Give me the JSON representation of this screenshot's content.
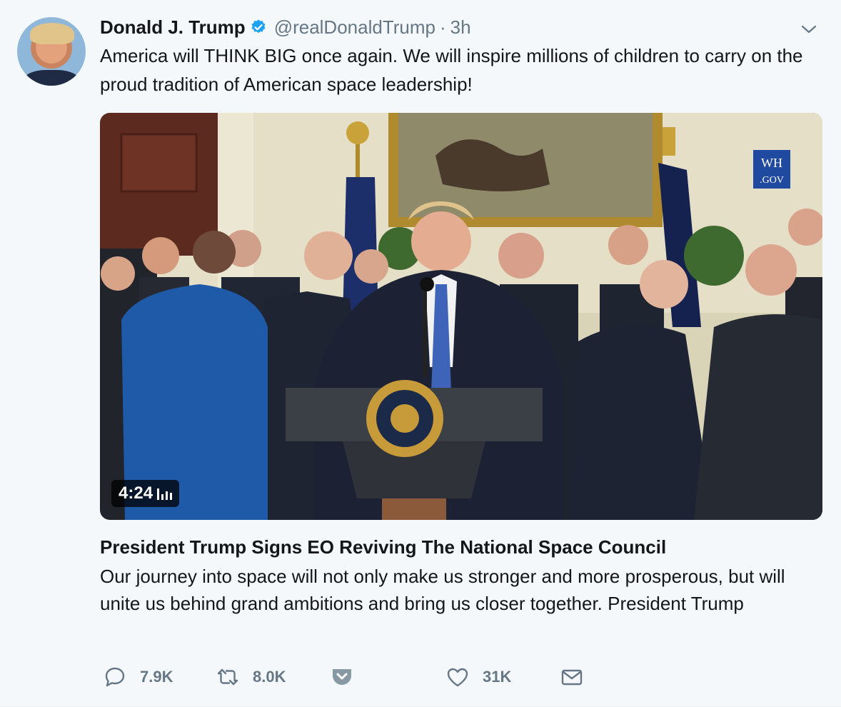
{
  "tweet": {
    "author_name": "Donald J. Trump",
    "handle": "@realDonaldTrump",
    "separator": "·",
    "time": "3h",
    "text": "America will THINK BIG once again. We will inspire millions of children to carry on the proud tradition of American space leadership!"
  },
  "media": {
    "duration": "4:24",
    "watermark_line1": "WH",
    "watermark_line2": ".GOV"
  },
  "card": {
    "title": "President Trump Signs EO Reviving The National Space Council",
    "description": "Our journey into space will not only make us stronger and more prosperous, but will unite us behind grand ambitions and bring us closer together. President Trump"
  },
  "actions": {
    "reply_count": "7.9K",
    "retweet_count": "8.0K",
    "like_count": "31K"
  },
  "colors": {
    "background": "#f5f8fa",
    "text": "#14171a",
    "secondary": "#657786",
    "verified": "#1da1f2"
  },
  "icons": [
    "verified-badge-icon",
    "chevron-down-icon",
    "reply-icon",
    "retweet-icon",
    "pocket-icon",
    "like-icon",
    "dm-icon",
    "views-bars-icon"
  ]
}
